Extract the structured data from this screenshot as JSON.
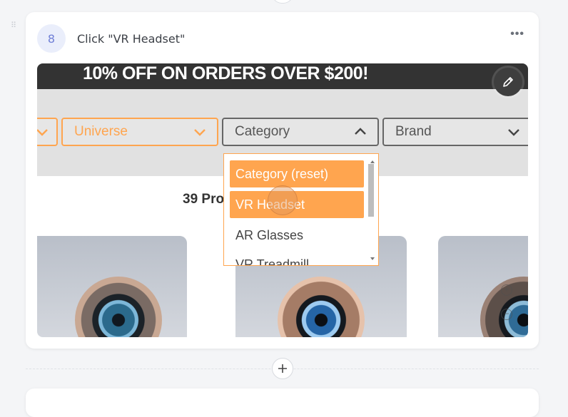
{
  "step": {
    "number": "8",
    "title": "Click \"VR Headset\"",
    "more_icon": "more-horizontal-icon"
  },
  "screenshot": {
    "promo": "10% OFF ON ORDERS OVER $200!",
    "filters": [
      {
        "label": "Universe",
        "state": "collapsed"
      },
      {
        "label": "Category",
        "state": "expanded"
      },
      {
        "label": "Brand",
        "state": "collapsed"
      }
    ],
    "dropdown_items": [
      {
        "label": "Category (reset)",
        "highlighted": true
      },
      {
        "label": "VR Headset",
        "highlighted": true
      },
      {
        "label": "AR Glasses",
        "highlighted": false
      },
      {
        "label": "VR Treadmill",
        "highlighted": false
      }
    ],
    "products_count": "39 Pro"
  },
  "colors": {
    "accent_orange": "#ffa54f",
    "promo_bg": "#333333",
    "badge_bg": "#eaeefb",
    "badge_text": "#6f7fd6"
  },
  "icons": {
    "edit": "pencil-icon",
    "add": "plus-icon",
    "drag": "drag-handle-icon",
    "zoom_in": "zoom-in-icon",
    "zoom_out": "zoom-out-icon"
  }
}
